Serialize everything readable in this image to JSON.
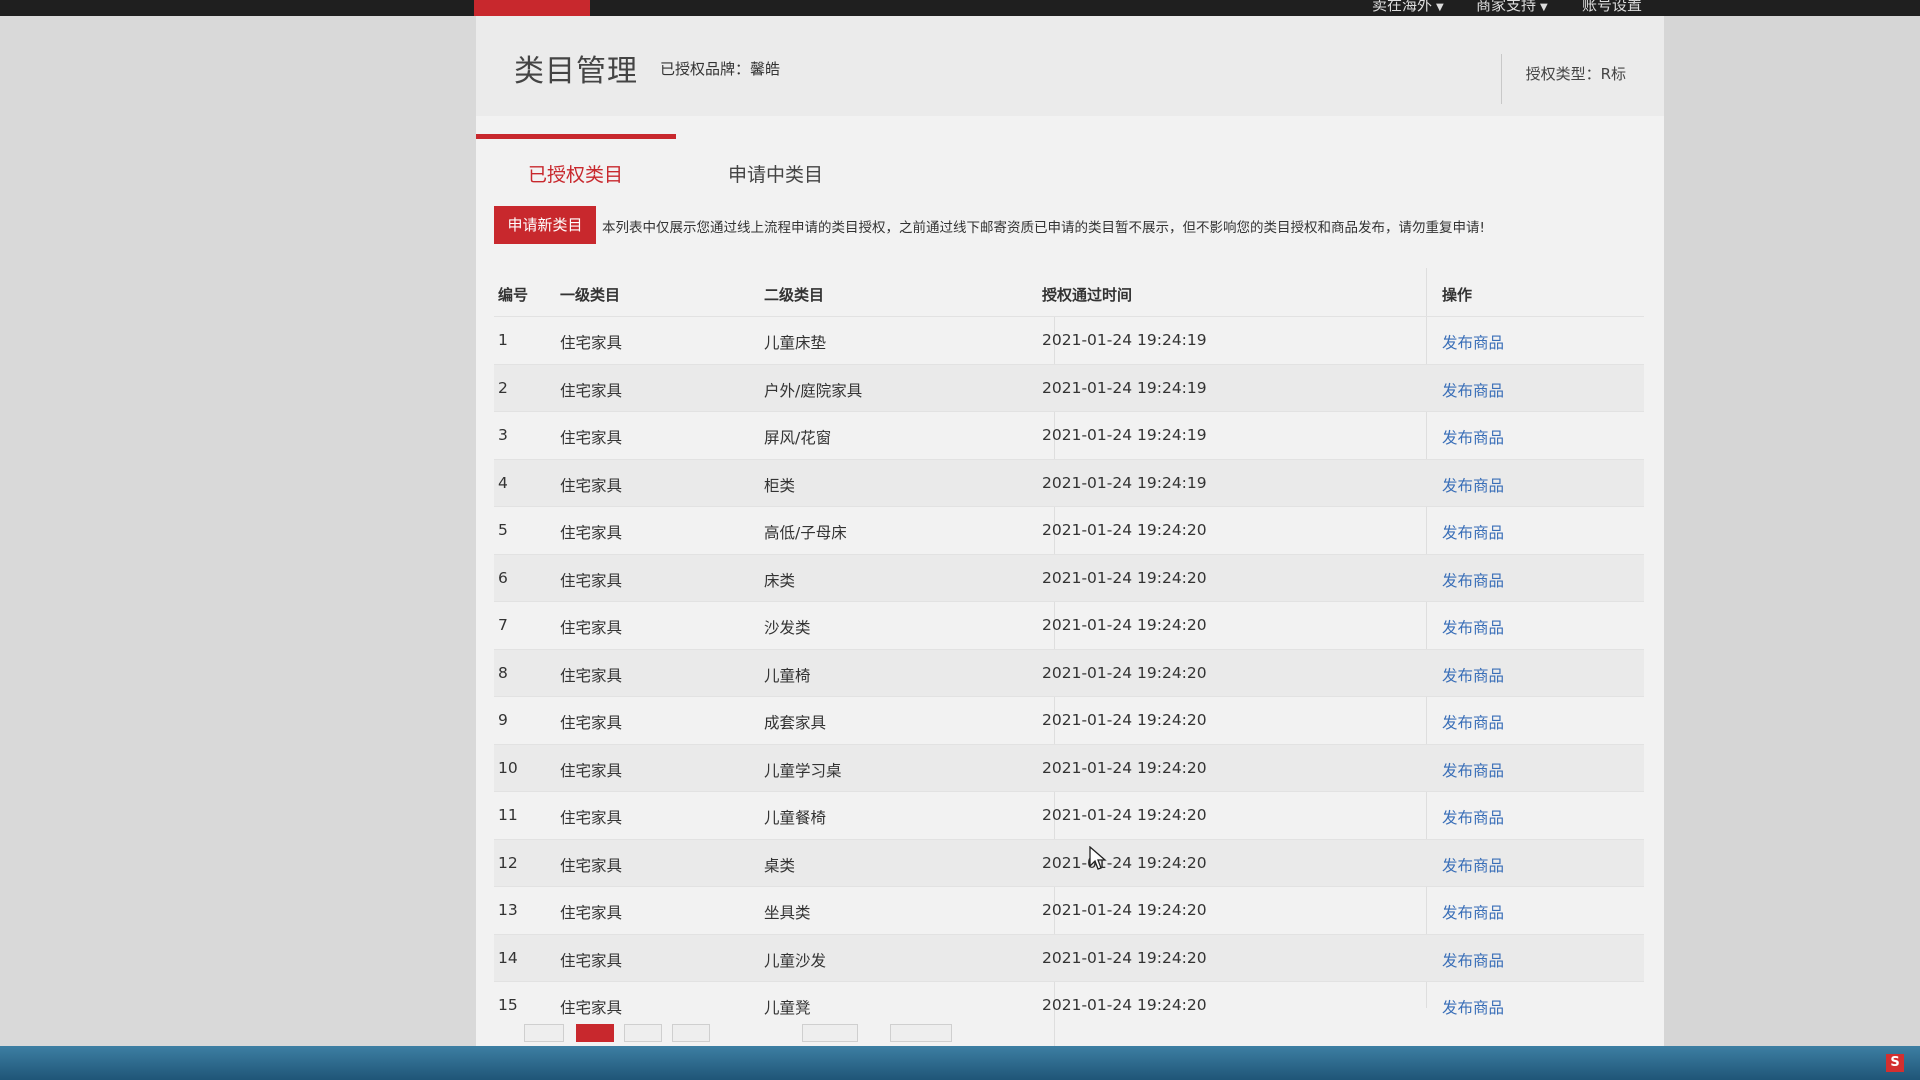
{
  "topbar": {
    "nav_items": [
      {
        "label": "卖在海外",
        "has_dropdown": true
      },
      {
        "label": "商家支持",
        "has_dropdown": true
      },
      {
        "label": "账号设置",
        "has_dropdown": false
      }
    ]
  },
  "header": {
    "title": "类目管理",
    "brand_label": "已授权品牌：馨皓",
    "auth_type": "授权类型：R标"
  },
  "tabs": [
    {
      "label": "已授权类目",
      "active": true
    },
    {
      "label": "申请中类目",
      "active": false
    }
  ],
  "notice": {
    "button_label": "申请新类目",
    "text": "本列表中仅展示您通过线上流程申请的类目授权，之前通过线下邮寄资质已申请的类目暂不展示，但不影响您的类目授权和商品发布，请勿重复申请!"
  },
  "table": {
    "columns": [
      "编号",
      "一级类目",
      "二级类目",
      "授权通过时间",
      "操作"
    ],
    "rows": [
      {
        "no": "1",
        "l1": "住宅家具",
        "l2": "儿童床垫",
        "time": "2021-01-24 19:24:19",
        "op": "发布商品"
      },
      {
        "no": "2",
        "l1": "住宅家具",
        "l2": "户外/庭院家具",
        "time": "2021-01-24 19:24:19",
        "op": "发布商品"
      },
      {
        "no": "3",
        "l1": "住宅家具",
        "l2": "屏风/花窗",
        "time": "2021-01-24 19:24:19",
        "op": "发布商品"
      },
      {
        "no": "4",
        "l1": "住宅家具",
        "l2": "柜类",
        "time": "2021-01-24 19:24:19",
        "op": "发布商品"
      },
      {
        "no": "5",
        "l1": "住宅家具",
        "l2": "高低/子母床",
        "time": "2021-01-24 19:24:20",
        "op": "发布商品"
      },
      {
        "no": "6",
        "l1": "住宅家具",
        "l2": "床类",
        "time": "2021-01-24 19:24:20",
        "op": "发布商品"
      },
      {
        "no": "7",
        "l1": "住宅家具",
        "l2": "沙发类",
        "time": "2021-01-24 19:24:20",
        "op": "发布商品"
      },
      {
        "no": "8",
        "l1": "住宅家具",
        "l2": "儿童椅",
        "time": "2021-01-24 19:24:20",
        "op": "发布商品"
      },
      {
        "no": "9",
        "l1": "住宅家具",
        "l2": "成套家具",
        "time": "2021-01-24 19:24:20",
        "op": "发布商品"
      },
      {
        "no": "10",
        "l1": "住宅家具",
        "l2": "儿童学习桌",
        "time": "2021-01-24 19:24:20",
        "op": "发布商品"
      },
      {
        "no": "11",
        "l1": "住宅家具",
        "l2": "儿童餐椅",
        "time": "2021-01-24 19:24:20",
        "op": "发布商品"
      },
      {
        "no": "12",
        "l1": "住宅家具",
        "l2": "桌类",
        "time": "2021-01-24 19:24:20",
        "op": "发布商品"
      },
      {
        "no": "13",
        "l1": "住宅家具",
        "l2": "坐具类",
        "time": "2021-01-24 19:24:20",
        "op": "发布商品"
      },
      {
        "no": "14",
        "l1": "住宅家具",
        "l2": "儿童沙发",
        "time": "2021-01-24 19:24:20",
        "op": "发布商品"
      },
      {
        "no": "15",
        "l1": "住宅家具",
        "l2": "儿童凳",
        "time": "2021-01-24 19:24:20",
        "op": "发布商品"
      }
    ]
  },
  "pagination": {
    "current_page": 2
  },
  "colors": {
    "accent": "#c8282d",
    "link": "#3a6fb8"
  }
}
